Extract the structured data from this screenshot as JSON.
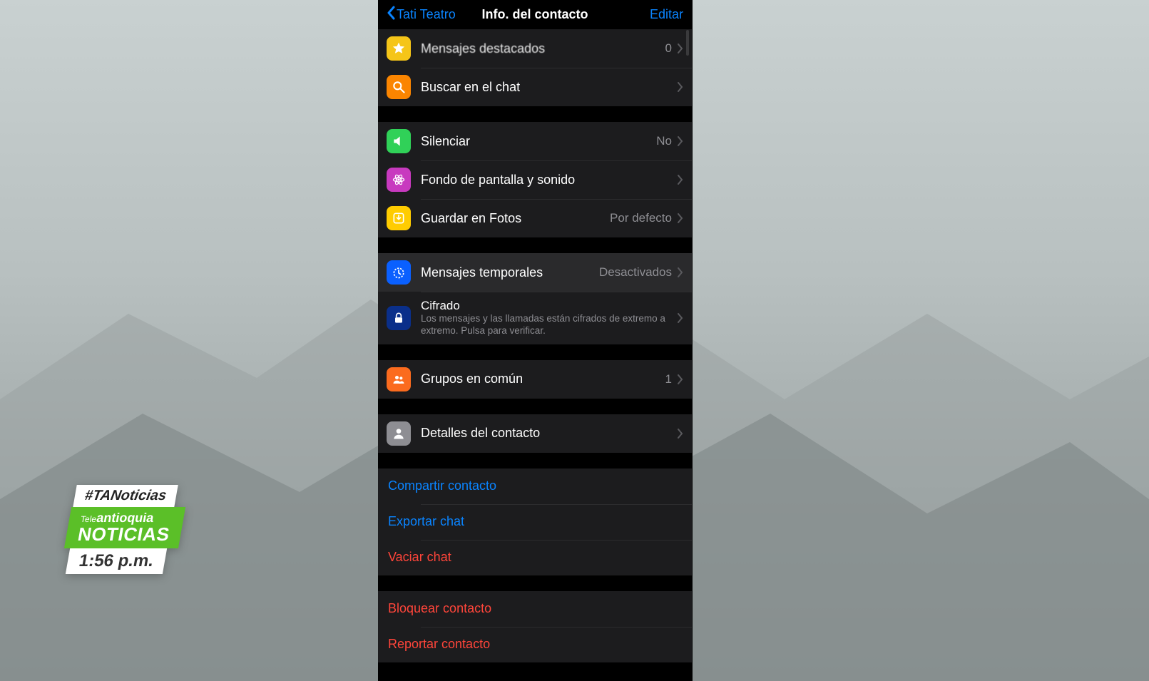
{
  "news": {
    "hashtag": "#TANoticias",
    "brand_tele": "Tele",
    "brand_ant": "antioquia",
    "noticias": "NOTICIAS",
    "time": "1:56 p.m."
  },
  "header": {
    "back_label": "Tati Teatro",
    "title": "Info. del contacto",
    "edit": "Editar"
  },
  "sections": {
    "chat": {
      "starred": {
        "label": "Mensajes destacados",
        "value": "0"
      },
      "search": {
        "label": "Buscar en el chat"
      }
    },
    "settings": {
      "mute": {
        "label": "Silenciar",
        "value": "No"
      },
      "wall": {
        "label": "Fondo de pantalla y sonido"
      },
      "save": {
        "label": "Guardar en Fotos",
        "value": "Por defecto"
      }
    },
    "privacy": {
      "disappearing": {
        "label": "Mensajes temporales",
        "value": "Desactivados"
      },
      "encryption": {
        "label": "Cifrado",
        "sub": "Los mensajes y las llamadas están cifrados de extremo a extremo. Pulsa para verificar."
      }
    },
    "groups": {
      "label": "Grupos en común",
      "value": "1"
    },
    "details": {
      "label": "Detalles del contacto"
    },
    "actions": {
      "share": "Compartir contacto",
      "export": "Exportar chat",
      "clear": "Vaciar chat",
      "block": "Bloquear contacto",
      "report": "Reportar contacto"
    }
  }
}
